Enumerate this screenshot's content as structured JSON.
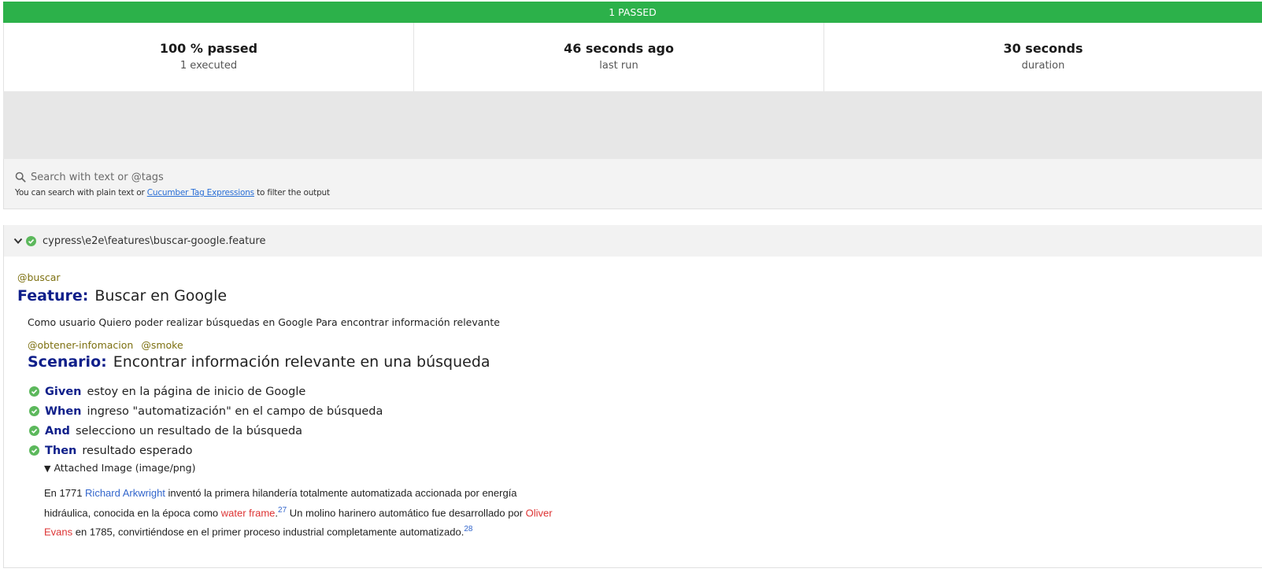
{
  "status_bar": {
    "text": "1 PASSED"
  },
  "stats": [
    {
      "value": "100 % passed",
      "label": "1 executed"
    },
    {
      "value": "46 seconds ago",
      "label": "last run"
    },
    {
      "value": "30 seconds",
      "label": "duration"
    }
  ],
  "search": {
    "placeholder": "Search with text or @tags",
    "help_prefix": "You can search with plain text or ",
    "help_link": "Cucumber Tag Expressions",
    "help_suffix": " to filter the output"
  },
  "feature_file": {
    "path": "cypress\\e2e\\features\\buscar-google.feature"
  },
  "feature": {
    "tag": "@buscar",
    "keyword": "Feature:",
    "name": "Buscar en Google",
    "description": "Como usuario Quiero poder realizar búsquedas en Google Para encontrar información relevante"
  },
  "scenario": {
    "tags": [
      "@obtener-infomacion",
      "@smoke"
    ],
    "keyword": "Scenario:",
    "name": "Encontrar información relevante en una búsqueda",
    "steps": [
      {
        "keyword": "Given",
        "text": "estoy en la página de inicio de Google"
      },
      {
        "keyword": "When",
        "text": "ingreso \"automatización\" en el campo de búsqueda"
      },
      {
        "keyword": "And",
        "text": "selecciono un resultado de la búsqueda"
      },
      {
        "keyword": "Then",
        "text": "resultado esperado"
      }
    ]
  },
  "attachment": {
    "toggle": "▼",
    "label": "Attached Image (image/png)",
    "article": {
      "t1": "En 1771 ",
      "link1": "Richard Arkwright",
      "t2": " inventó la primera hilandería totalmente automatizada accionada por energía hidráulica, conocida en la época como ",
      "link2": "water frame",
      "t3": ".",
      "ref1": "27",
      "t4": "  Un molino harinero automático fue desarrollado por ",
      "link3": "Oliver Evans",
      "t5": " en 1785, convirtiéndose en el primer proceso industrial completamente automatizado.",
      "ref2": "28"
    }
  },
  "colors": {
    "passed": "#2cb14a",
    "keyword": "#0f1f8a",
    "tag": "#7d7010",
    "link": "#3366cc",
    "redlink": "#dd3333"
  }
}
